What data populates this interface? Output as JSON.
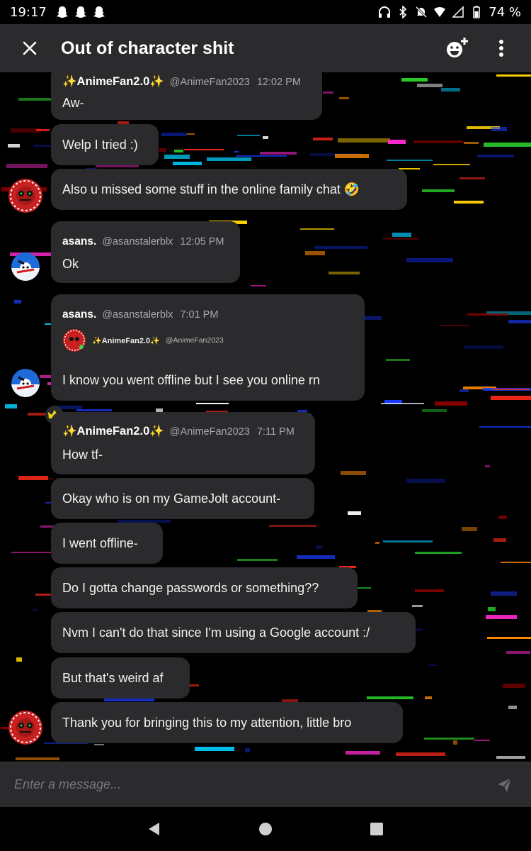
{
  "status": {
    "time": "19:17",
    "battery": "74 %"
  },
  "header": {
    "title": "Out of character shit"
  },
  "messages": [
    {
      "meta": {
        "name": "✨AnimeFan2.0✨",
        "handle": "@AnimeFan2023",
        "time": "12:02 PM"
      },
      "text": "Aw-"
    },
    {
      "text": "Welp I tried :)"
    },
    {
      "text": "Also u missed some stuff in the online family chat 🤣"
    },
    {
      "meta": {
        "name": "asans.",
        "handle": "@asanstalerblx",
        "time": "12:05 PM"
      },
      "text": "Ok"
    },
    {
      "meta": {
        "name": "asans.",
        "handle": "@asanstalerblx",
        "time": "7:01 PM"
      },
      "quote": {
        "name": "✨AnimeFan2.0✨",
        "handle": "@AnimeFan2023"
      },
      "text": "I know you went offline but I see you online rn"
    },
    {
      "meta": {
        "name": "✨AnimeFan2.0✨",
        "handle": "@AnimeFan2023",
        "time": "7:11 PM"
      },
      "text": "How tf-"
    },
    {
      "text": "Okay who is on my GameJolt account-"
    },
    {
      "text": "I went offline-"
    },
    {
      "text": "Do I gotta change passwords or something??"
    },
    {
      "text": "Nvm I can't do that since I'm using a Google account :/"
    },
    {
      "text": "But that's weird af"
    },
    {
      "text": "Thank you for bringing this to my attention, little bro"
    }
  ],
  "input": {
    "placeholder": "Enter a message..."
  },
  "icons": {
    "close": "close-icon",
    "add_member": "add-emoji-person-icon",
    "more": "more-vert-icon",
    "send": "send-icon"
  },
  "colors": {
    "bubble": "#2b2b2e",
    "header": "#2b2b2e",
    "background": "#000000"
  }
}
